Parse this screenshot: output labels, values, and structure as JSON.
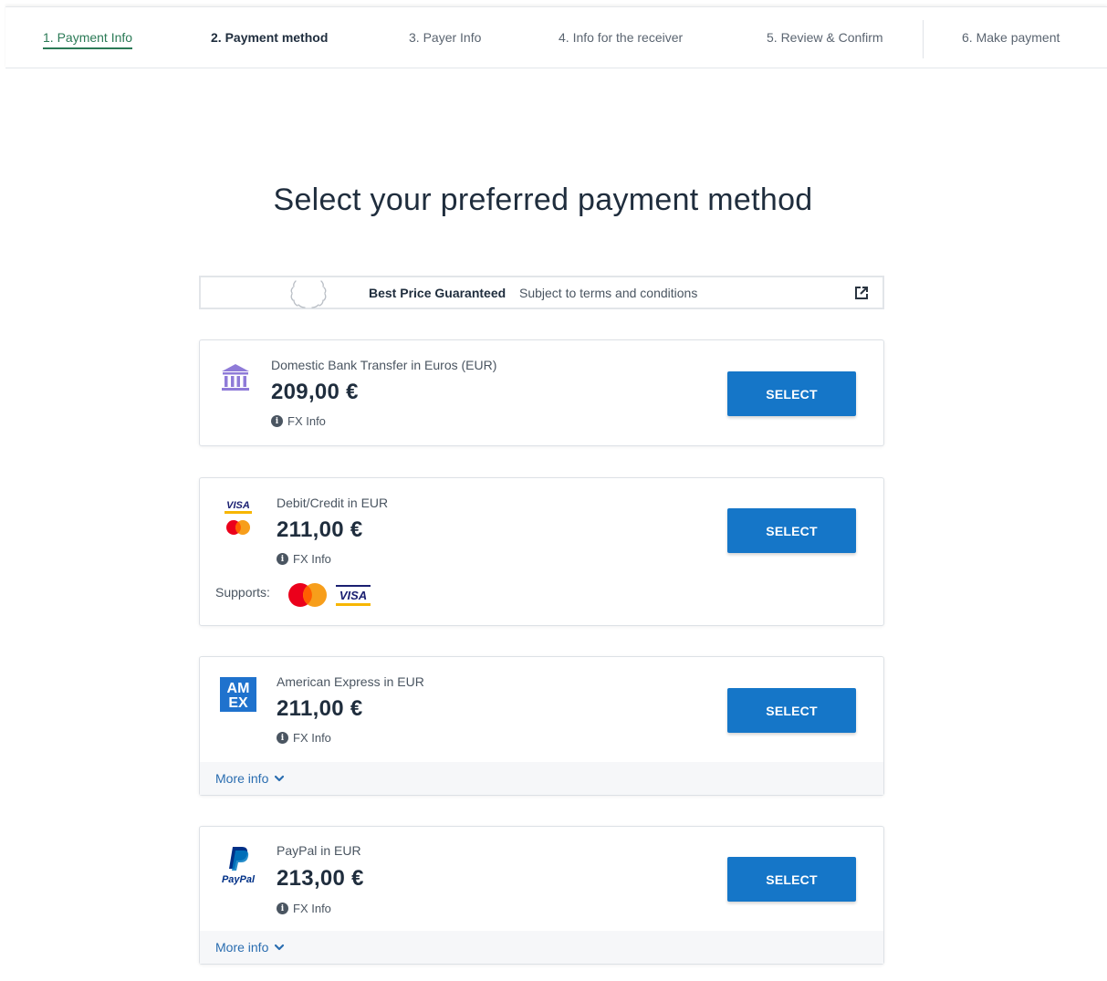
{
  "steps": [
    {
      "label": "1. Payment Info",
      "state": "done"
    },
    {
      "label": "2. Payment method",
      "state": "active"
    },
    {
      "label": "3. Payer Info",
      "state": "pending"
    },
    {
      "label": "4. Info for the receiver",
      "state": "pending"
    },
    {
      "label": "5. Review & Confirm",
      "state": "pending"
    },
    {
      "label": "6. Make payment",
      "state": "pending"
    }
  ],
  "page_title": "Select your preferred payment method",
  "banner": {
    "strong": "Best Price Guaranteed",
    "sub": "Subject to terms and conditions",
    "icons": [
      "laurel-wreath-icon",
      "external-link-icon"
    ]
  },
  "methods": [
    {
      "name": "Domestic Bank Transfer in Euros (EUR)",
      "price": "209,00 €",
      "fx_label": "FX Info",
      "select_label": "SELECT",
      "icon": "bank-icon"
    },
    {
      "name": "Debit/Credit in EUR",
      "price": "211,00 €",
      "fx_label": "FX Info",
      "select_label": "SELECT",
      "icon": "visa-mastercard-icon",
      "supports_label": "Supports:"
    },
    {
      "name": "American Express in EUR",
      "price": "211,00 €",
      "fx_label": "FX Info",
      "select_label": "SELECT",
      "icon": "amex-icon",
      "more_label": "More info"
    },
    {
      "name": "PayPal in EUR",
      "price": "213,00 €",
      "fx_label": "FX Info",
      "select_label": "SELECT",
      "icon": "paypal-icon",
      "more_label": "More info"
    }
  ],
  "logos": {
    "visa": "VISA",
    "amex_top": "AM",
    "amex_bottom": "EX",
    "paypal": "PayPal"
  },
  "colors": {
    "primary_button": "#1576c8",
    "done_step": "#2b7a56",
    "link": "#2a6db0",
    "bank_icon": "#8f7bd8"
  }
}
